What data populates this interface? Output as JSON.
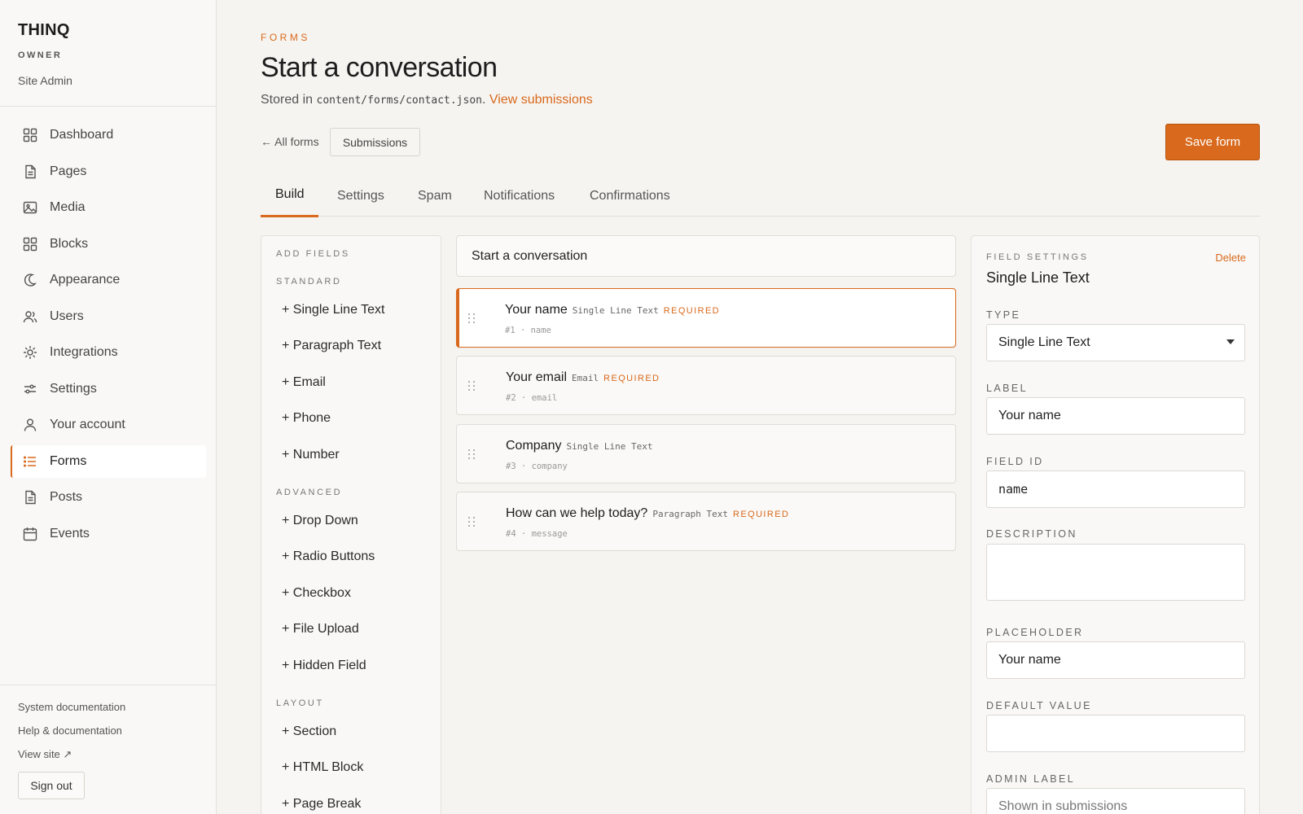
{
  "sidebar": {
    "brand": "THINQ",
    "role": "OWNER",
    "site": "Site Admin",
    "nav": [
      {
        "label": "Dashboard",
        "icon": "dashboard-grid-icon"
      },
      {
        "label": "Pages",
        "icon": "page-icon"
      },
      {
        "label": "Media",
        "icon": "image-icon"
      },
      {
        "label": "Blocks",
        "icon": "blocks-grid-icon"
      },
      {
        "label": "Appearance",
        "icon": "appearance-icon"
      },
      {
        "label": "Users",
        "icon": "users-icon"
      },
      {
        "label": "Integrations",
        "icon": "integrations-icon"
      },
      {
        "label": "Settings",
        "icon": "sliders-icon"
      },
      {
        "label": "Your account",
        "icon": "person-icon"
      },
      {
        "label": "Forms",
        "icon": "list-icon",
        "active": true
      },
      {
        "label": "Posts",
        "icon": "document-icon"
      },
      {
        "label": "Events",
        "icon": "calendar-icon"
      }
    ],
    "footer": {
      "system_docs": "System documentation",
      "help_docs": "Help & documentation",
      "view_site": "View site ↗",
      "sign_out": "Sign out"
    }
  },
  "header": {
    "eyebrow": "FORMS",
    "title": "Start a conversation",
    "stored_prefix": "Stored in",
    "stored_path": "content/forms/contact.json",
    "stored_suffix": ".",
    "view_submissions": "View submissions",
    "all_forms": "← All forms",
    "submissions_button": "Submissions",
    "save_button": "Save form"
  },
  "tabs": [
    {
      "label": "Build",
      "active": true
    },
    {
      "label": "Settings"
    },
    {
      "label": "Spam"
    },
    {
      "label": "Notifications"
    },
    {
      "label": "Confirmations"
    }
  ],
  "add_fields": {
    "title": "ADD FIELDS",
    "standard_label": "STANDARD",
    "standard": [
      "+ Single Line Text",
      "+ Paragraph Text",
      "+ Email",
      "+ Phone",
      "+ Number"
    ],
    "advanced_label": "ADVANCED",
    "advanced": [
      "+ Drop Down",
      "+ Radio Buttons",
      "+ Checkbox",
      "+ File Upload",
      "+ Hidden Field"
    ],
    "layout_label": "LAYOUT",
    "layout": [
      "+ Section",
      "+ HTML Block",
      "+ Page Break"
    ]
  },
  "canvas": {
    "form_title": "Start a conversation",
    "fields": [
      {
        "label": "Your name",
        "type": "Single Line Text",
        "required": "REQUIRED",
        "meta": "#1 · name",
        "selected": true
      },
      {
        "label": "Your email",
        "type": "Email",
        "required": "REQUIRED",
        "meta": "#2 · email"
      },
      {
        "label": "Company",
        "type": "Single Line Text",
        "required": "",
        "meta": "#3 · company"
      },
      {
        "label": "How can we help today?",
        "type": "Paragraph Text",
        "required": "REQUIRED",
        "meta": "#4 · message"
      }
    ]
  },
  "field_settings": {
    "eyebrow": "FIELD SETTINGS",
    "delete": "Delete",
    "title": "Single Line Text",
    "type_label": "TYPE",
    "type_value": "Single Line Text",
    "label_label": "LABEL",
    "label_value": "Your name",
    "field_id_label": "FIELD ID",
    "field_id_value": "name",
    "description_label": "DESCRIPTION",
    "description_value": "",
    "placeholder_label": "PLACEHOLDER",
    "placeholder_value": "Your name",
    "default_label": "DEFAULT VALUE",
    "default_value": "",
    "admin_label_label": "ADMIN LABEL",
    "admin_label_placeholder": "Shown in submissions"
  },
  "colors": {
    "accent": "#d9691c",
    "background": "#f6f4f1",
    "panel": "#f9f8f6"
  }
}
